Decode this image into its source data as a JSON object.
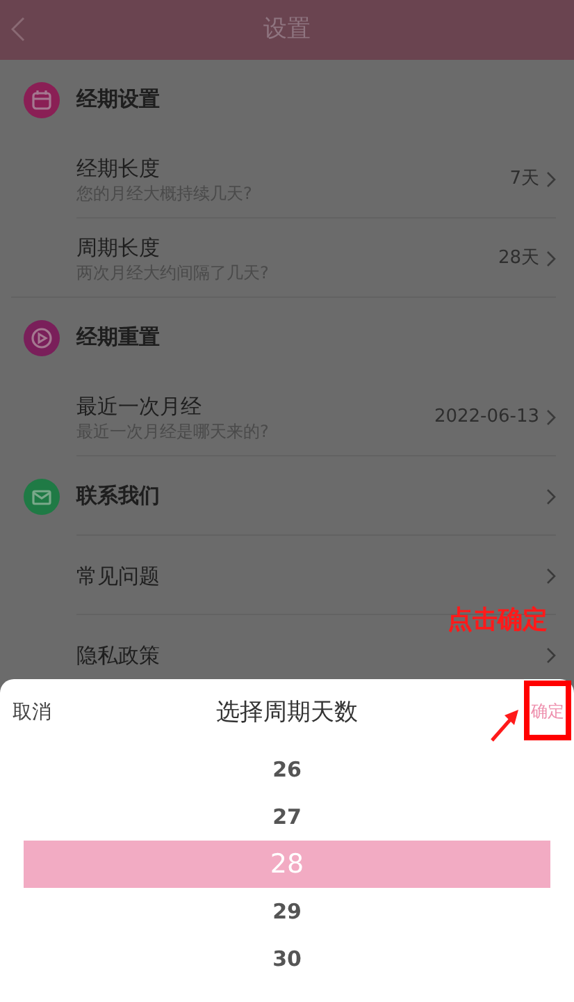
{
  "header": {
    "title": "设置"
  },
  "rows": [
    {
      "kind": "section",
      "title": "经期设置",
      "color": "#8a1f55"
    },
    {
      "kind": "item",
      "title": "经期长度",
      "subtitle": "您的月经大概持续几天?",
      "value": "7天"
    },
    {
      "kind": "item",
      "title": "周期长度",
      "subtitle": "两次月经大约间隔了几天?",
      "value": "28天"
    },
    {
      "kind": "section",
      "title": "经期重置",
      "color": "#7a1f5a"
    },
    {
      "kind": "item",
      "title": "最近一次月经",
      "subtitle": "最近一次月经是哪天来的?",
      "value": "2022-06-13"
    },
    {
      "kind": "section_link",
      "title": "联系我们",
      "color": "#1f7a45"
    },
    {
      "kind": "link",
      "title": "常见问题"
    },
    {
      "kind": "link",
      "title": "隐私政策"
    }
  ],
  "annotation": {
    "text": "点击确定"
  },
  "picker": {
    "cancel": "取消",
    "title": "选择周期天数",
    "confirm": "确定",
    "options": [
      {
        "label": "26",
        "selected": false
      },
      {
        "label": "27",
        "selected": false
      },
      {
        "label": "28",
        "selected": true
      },
      {
        "label": "29",
        "selected": false
      },
      {
        "label": "30",
        "selected": false
      }
    ]
  }
}
